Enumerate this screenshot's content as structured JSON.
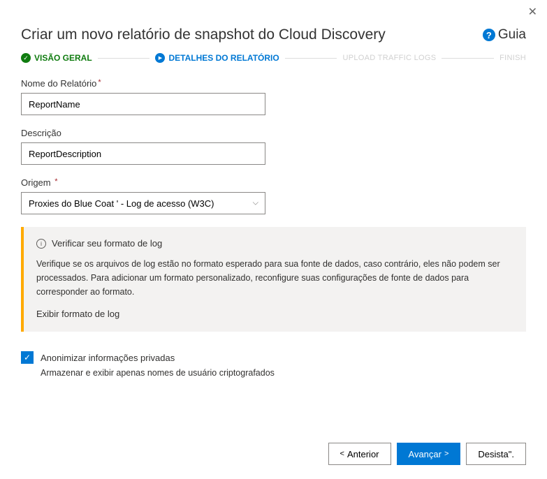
{
  "header": {
    "title": "Criar um novo relatório de snapshot do Cloud Discovery",
    "guide_label": "Guia"
  },
  "steps": {
    "s1": "VISÃO GERAL",
    "s2": "DETALHES DO RELATÓRIO",
    "s3": "UPLOAD TRAFFIC LOGS",
    "s4": "FINISH"
  },
  "form": {
    "name_label": "Nome do Relatório",
    "name_value": "ReportName",
    "desc_label": "Descrição",
    "desc_value": "ReportDescription",
    "source_label": "Origem",
    "source_value": "Proxies do Blue Coat ' - Log de acesso (W3C)"
  },
  "info": {
    "title": "Verificar seu formato de log",
    "text": "Verifique se os arquivos de log estão no formato esperado para sua fonte de dados, caso contrário, eles não podem ser processados. Para adicionar um formato personalizado, reconfigure suas configurações de fonte de dados para corresponder ao formato.",
    "link": "Exibir formato de log"
  },
  "anon": {
    "label": "Anonimizar informações privadas",
    "sub": "Armazenar e exibir apenas nomes de usuário criptografados"
  },
  "footer": {
    "prev": "Anterior",
    "next": "Avançar",
    "cancel": "Desista\"."
  }
}
